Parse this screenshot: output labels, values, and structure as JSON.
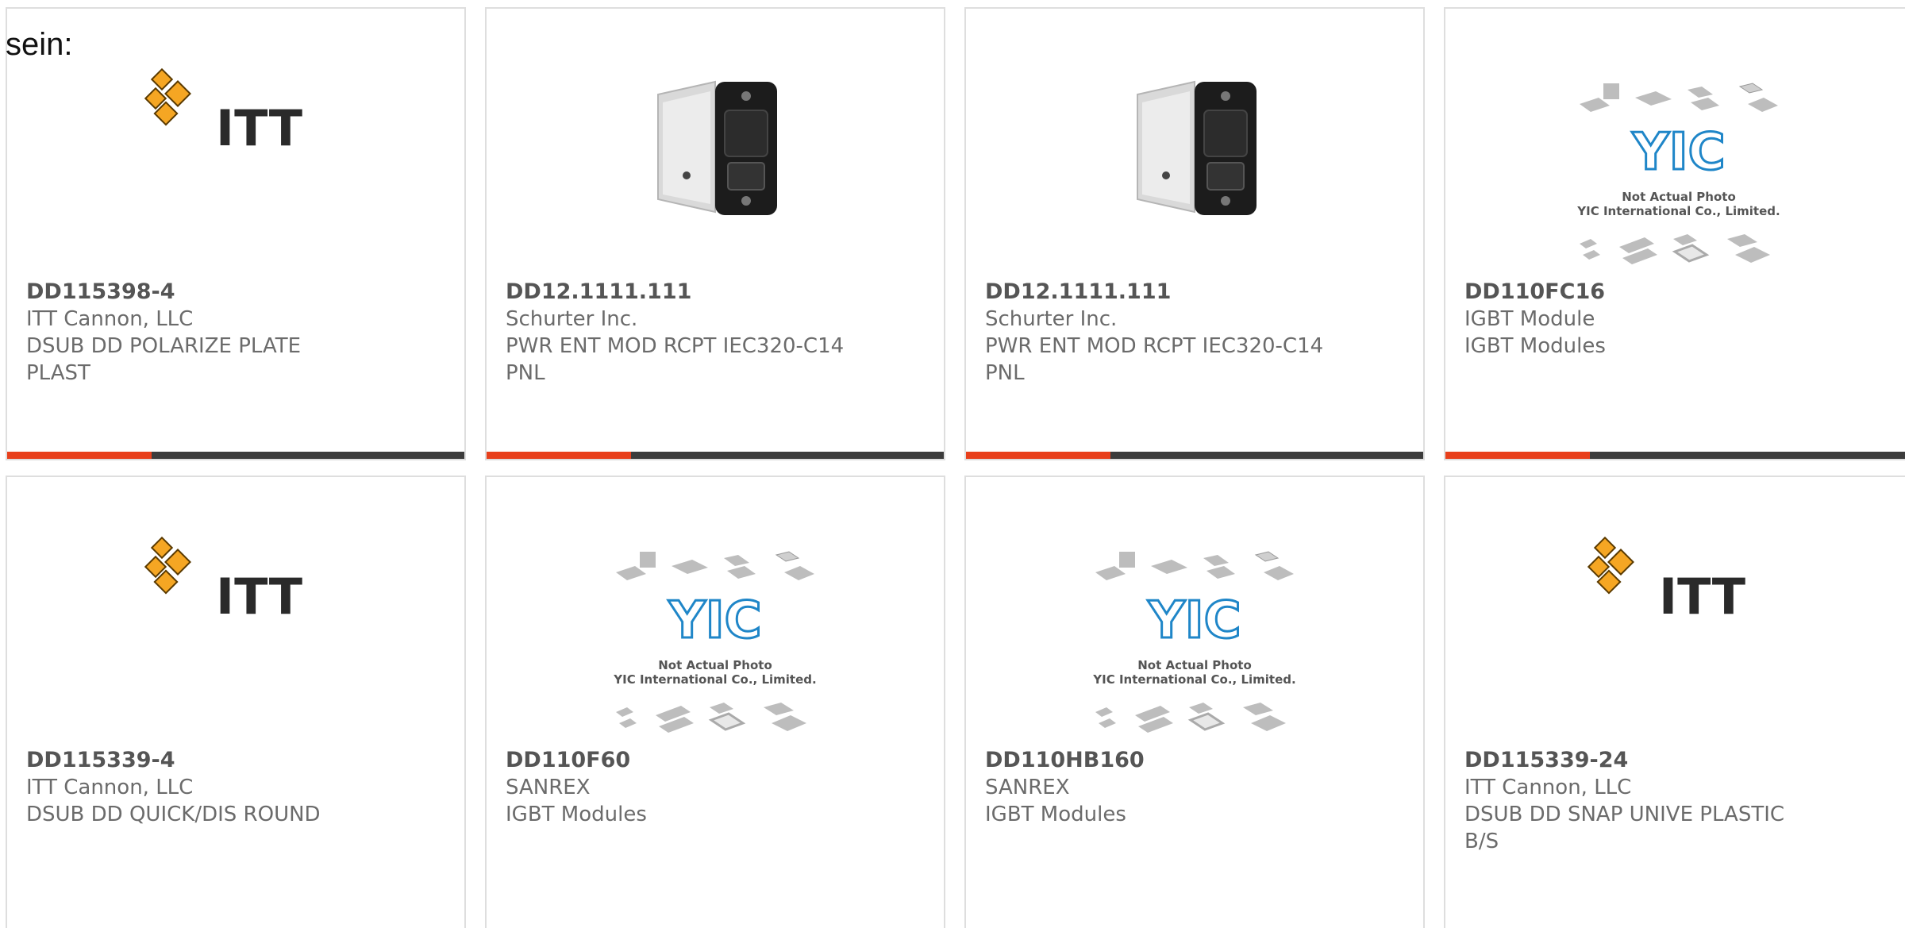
{
  "header_fragment": "sein:",
  "colors": {
    "accent": "#e8401c",
    "bar_dark": "#3c3c3c",
    "itt_orange": "#f5a623",
    "yic_blue": "#1f86c8"
  },
  "products": [
    {
      "part_number": "DD115398-4",
      "manufacturer": "ITT Cannon, LLC",
      "description": "DSUB DD POLARIZE PLATE PLAST",
      "image": "itt-logo",
      "logo_text": "ITT"
    },
    {
      "part_number": "DD12.1111.111",
      "manufacturer": "Schurter Inc.",
      "description": "PWR ENT MOD RCPT IEC320-C14 PNL",
      "image": "power-entry-module"
    },
    {
      "part_number": "DD12.1111.111",
      "manufacturer": "Schurter Inc.",
      "description": "PWR ENT MOD RCPT IEC320-C14 PNL",
      "image": "power-entry-module"
    },
    {
      "part_number": "DD110FC16",
      "manufacturer": "IGBT Module",
      "description": "IGBT Modules",
      "image": "yic-placeholder",
      "logo_text": "YIC",
      "photo_note_1": "Not Actual Photo",
      "photo_note_2": "YIC International Co., Limited."
    },
    {
      "part_number": "DD115339-4",
      "manufacturer": "ITT Cannon, LLC",
      "description": "DSUB DD QUICK/DIS ROUND",
      "image": "itt-logo",
      "logo_text": "ITT"
    },
    {
      "part_number": "DD110F60",
      "manufacturer": "SANREX",
      "description": "IGBT Modules",
      "image": "yic-placeholder",
      "logo_text": "YIC",
      "photo_note_1": "Not Actual Photo",
      "photo_note_2": "YIC International Co., Limited."
    },
    {
      "part_number": "DD110HB160",
      "manufacturer": "SANREX",
      "description": "IGBT Modules",
      "image": "yic-placeholder",
      "logo_text": "YIC",
      "photo_note_1": "Not Actual Photo",
      "photo_note_2": "YIC International Co., Limited."
    },
    {
      "part_number": "DD115339-24",
      "manufacturer": "ITT Cannon, LLC",
      "description": "DSUB DD SNAP UNIVE PLASTIC B/S",
      "image": "itt-logo",
      "logo_text": "ITT"
    }
  ]
}
